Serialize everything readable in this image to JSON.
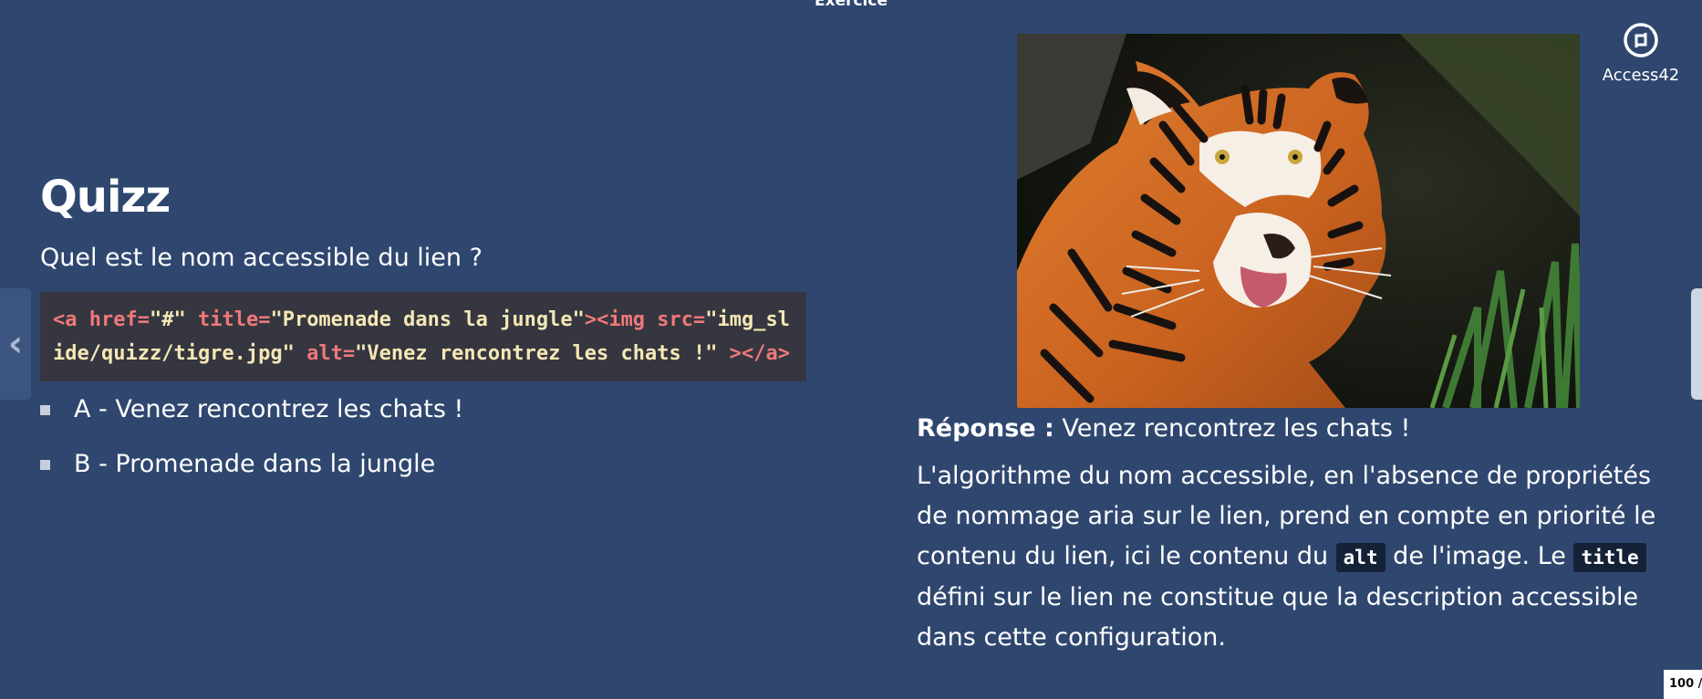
{
  "header": {
    "title": "Exercice"
  },
  "logo": {
    "label": "Access42"
  },
  "navigation": {
    "prev_icon": "chevron-left-icon",
    "next_icon": "slide-next-handle"
  },
  "quiz": {
    "title": "Quizz",
    "question": "Quel est le nom accessible du lien ?",
    "code": {
      "t1": "<a ",
      "a1": "href=",
      "s1": "\"#\"",
      "a2": " title=",
      "s2": "\"Promenade dans la jungle\"",
      "t2": "><img",
      "a3": " src=",
      "s3": "\"img_slide/quizz/tigre.jpg\"",
      "a4": " alt=",
      "s4": "\"Venez rencontrez les chats !\"",
      "t3": " ></a>"
    },
    "options": [
      {
        "label": "A - Venez rencontrez les chats !"
      },
      {
        "label": "B - Promenade dans la jungle"
      }
    ]
  },
  "answer": {
    "label": "Réponse :",
    "value": " Venez rencontrez les chats !",
    "explanation_1": "L'algorithme du nom accessible, en l'absence de propriétés de nommage aria sur le lien, prend en compte en priorité le contenu du lien, ici le contenu du ",
    "code_alt": "alt",
    "explanation_2": " de l'image. Le ",
    "code_title": "title",
    "explanation_3": " défini sur le lien ne constitue que la description accessible dans cette configuration."
  },
  "image": {
    "icon": "tiger-photo"
  },
  "footer": {
    "page": "100 /"
  },
  "colors": {
    "background": "#2f476f",
    "code_bg": "#35363f",
    "code_tag": "#f0787a",
    "code_string": "#f6e8b5",
    "inline_code_bg": "#152136"
  }
}
